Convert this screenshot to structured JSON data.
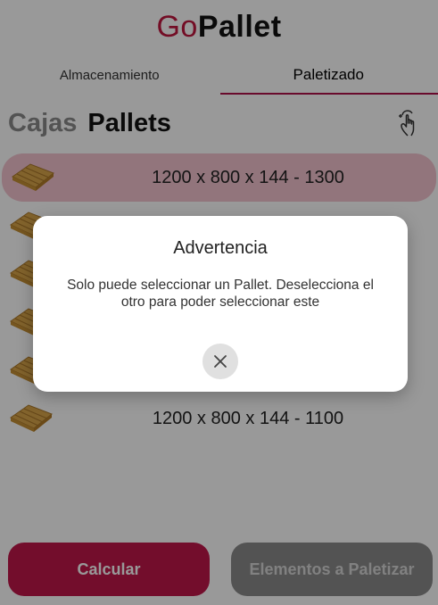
{
  "app": {
    "logo_part1": "Go",
    "logo_part2": "Pallet"
  },
  "tabs": [
    {
      "label": "Almacenamiento",
      "active": false
    },
    {
      "label": "Paletizado",
      "active": true
    }
  ],
  "segment": {
    "cajas": "Cajas",
    "pallets": "Pallets",
    "icon": "tap-hand-icon"
  },
  "pallets": [
    {
      "label": "1200 x 800 x 144 - 1300",
      "selected": true
    },
    {
      "label": "",
      "selected": false
    },
    {
      "label": "",
      "selected": false
    },
    {
      "label": "",
      "selected": false
    },
    {
      "label": "",
      "selected": false
    },
    {
      "label": "1200 x 800 x 144 - 1100",
      "selected": false
    }
  ],
  "buttons": {
    "calcular": "Calcular",
    "elementos": "Elementos a Paletizar"
  },
  "dialog": {
    "title": "Advertencia",
    "message": "Solo puede seleccionar un Pallet. Deselecciona el otro para poder seleccionar este",
    "close_icon": "close-icon"
  },
  "colors": {
    "brand": "#c0173f",
    "selected_row": "#f3c4cf",
    "button_primary": "#c0174a",
    "button_secondary": "#8a8a8a"
  }
}
